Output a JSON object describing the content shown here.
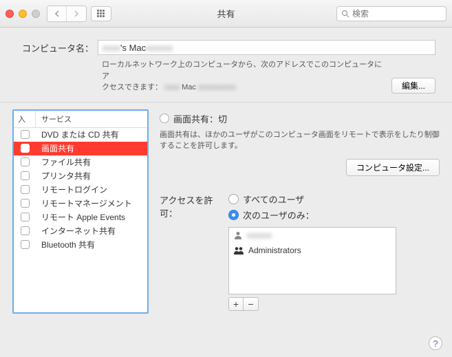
{
  "window": {
    "title": "共有"
  },
  "search": {
    "placeholder": "検索"
  },
  "computer_name": {
    "label": "コンピュータ名：",
    "value_prefix": "",
    "value_visible": "'s Mac",
    "desc_line1": "ローカルネットワーク上のコンピュータから、次のアドレスでこのコンピュータにア",
    "desc_line2_prefix": "クセスできます：",
    "desc_line2_value": "Mac",
    "edit_button": "編集..."
  },
  "services": {
    "header_on": "入",
    "header_name": "サービス",
    "items": [
      {
        "label": "DVD または CD 共有",
        "on": false,
        "selected": false
      },
      {
        "label": "画面共有",
        "on": false,
        "selected": true
      },
      {
        "label": "ファイル共有",
        "on": false,
        "selected": false
      },
      {
        "label": "プリンタ共有",
        "on": false,
        "selected": false
      },
      {
        "label": "リモートログイン",
        "on": false,
        "selected": false
      },
      {
        "label": "リモートマネージメント",
        "on": false,
        "selected": false
      },
      {
        "label": "リモート Apple Events",
        "on": false,
        "selected": false
      },
      {
        "label": "インターネット共有",
        "on": false,
        "selected": false
      },
      {
        "label": "Bluetooth 共有",
        "on": false,
        "selected": false
      }
    ]
  },
  "detail": {
    "status_title": "画面共有：切",
    "status_desc": "画面共有は、ほかのユーザがこのコンピュータ画面をリモートで表示をしたり制御することを許可します。",
    "computer_settings_button": "コンピュータ設定...",
    "access_label": "アクセスを許可：",
    "opt_all": "すべてのユーザ",
    "opt_only": "次のユーザのみ：",
    "selected_option": "only",
    "users": [
      {
        "name": "",
        "icon": "person",
        "dim": true
      },
      {
        "name": "Administrators",
        "icon": "group",
        "dim": false
      }
    ],
    "add_label": "+",
    "remove_label": "−"
  },
  "help_label": "?"
}
